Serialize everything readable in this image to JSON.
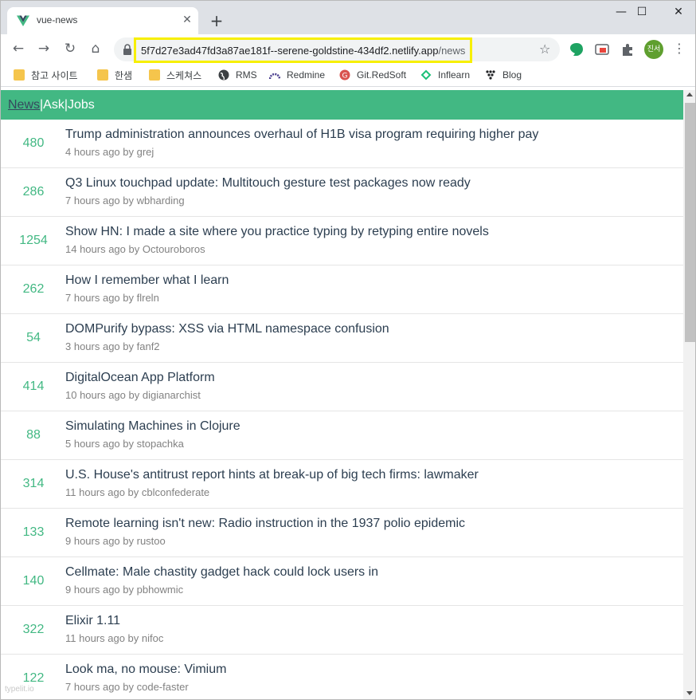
{
  "browser": {
    "tab_title": "vue-news",
    "tab_close": "✕",
    "new_tab": "+",
    "window_controls": {
      "minimize": "—",
      "maximize": "☐",
      "close": "✕"
    },
    "url_host": "5f7d27e3ad47fd3a87ae181f--serene-goldstine-434df2.netlify.app",
    "url_path": "/news",
    "profile_label": "진서",
    "highlight_color": "#f7ef00",
    "bookmarks": [
      {
        "label": "참고 사이트",
        "icon": "folder-icon"
      },
      {
        "label": "한샘",
        "icon": "folder-icon"
      },
      {
        "label": "스케쳐스",
        "icon": "folder-icon"
      },
      {
        "label": "RMS",
        "icon": "globe-icon"
      },
      {
        "label": "Redmine",
        "icon": "redmine-icon"
      },
      {
        "label": "Git.RedSoft",
        "icon": "gitlab-icon"
      },
      {
        "label": "Inflearn",
        "icon": "inflearn-icon"
      },
      {
        "label": "Blog",
        "icon": "blog-icon"
      }
    ]
  },
  "page": {
    "accent_color": "#42b883",
    "nav": {
      "news": "News",
      "ask": "Ask",
      "jobs": "Jobs",
      "separator": "|"
    },
    "items": [
      {
        "points": "480",
        "title": "Trump administration announces overhaul of H1B visa program requiring higher pay",
        "meta": "4 hours ago by grej"
      },
      {
        "points": "286",
        "title": "Q3 Linux touchpad update: Multitouch gesture test packages now ready",
        "meta": "7 hours ago by wbharding"
      },
      {
        "points": "1254",
        "title": "Show HN: I made a site where you practice typing by retyping entire novels",
        "meta": "14 hours ago by Octouroboros"
      },
      {
        "points": "262",
        "title": "How I remember what I learn",
        "meta": "7 hours ago by flreln"
      },
      {
        "points": "54",
        "title": "DOMPurify bypass: XSS via HTML namespace confusion",
        "meta": "3 hours ago by fanf2"
      },
      {
        "points": "414",
        "title": "DigitalOcean App Platform",
        "meta": "10 hours ago by digianarchist"
      },
      {
        "points": "88",
        "title": "Simulating Machines in Clojure",
        "meta": "5 hours ago by stopachka"
      },
      {
        "points": "314",
        "title": "U.S. House's antitrust report hints at break-up of big tech firms: lawmaker",
        "meta": "11 hours ago by cblconfederate"
      },
      {
        "points": "133",
        "title": "Remote learning isn't new: Radio instruction in the 1937 polio epidemic",
        "meta": "9 hours ago by rustoo"
      },
      {
        "points": "140",
        "title": "Cellmate: Male chastity gadget hack could lock users in",
        "meta": "9 hours ago by pbhowmic"
      },
      {
        "points": "322",
        "title": "Elixir 1.11",
        "meta": "11 hours ago by nifoc"
      },
      {
        "points": "122",
        "title": "Look ma, no mouse: Vimium",
        "meta": "7 hours ago by code-faster"
      }
    ]
  },
  "watermark": "typelit.io"
}
